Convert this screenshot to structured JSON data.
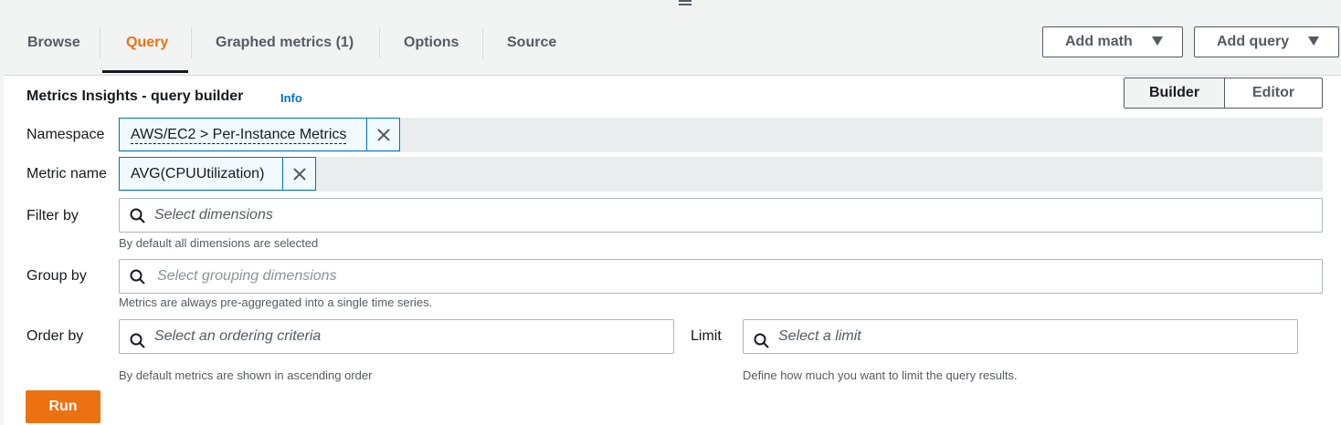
{
  "tabs": [
    {
      "label": "Browse",
      "active": false
    },
    {
      "label": "Query",
      "active": true
    },
    {
      "label": "Graphed metrics (1)",
      "active": false
    },
    {
      "label": "Options",
      "active": false
    },
    {
      "label": "Source",
      "active": false
    }
  ],
  "header_buttons": {
    "add_math": "Add math",
    "add_query": "Add query"
  },
  "builder": {
    "title": "Metrics Insights - query builder",
    "info": "Info",
    "modes": {
      "builder": "Builder",
      "editor": "Editor",
      "active": "Builder"
    },
    "namespace": {
      "label": "Namespace",
      "value": "AWS/EC2 > Per-Instance Metrics"
    },
    "metric_name": {
      "label": "Metric name",
      "value": "AVG(CPUUtilization)"
    },
    "filter_by": {
      "label": "Filter by",
      "placeholder": "Select dimensions",
      "help": "By default all dimensions are selected"
    },
    "group_by": {
      "label": "Group by",
      "placeholder": "Select grouping dimensions",
      "help": "Metrics are always pre-aggregated into a single time series."
    },
    "order_by": {
      "label": "Order by",
      "placeholder": "Select an ordering criteria",
      "help": "By default metrics are shown in ascending order"
    },
    "limit": {
      "label": "Limit",
      "placeholder": "Select a limit",
      "help": "Define how much you want to limit the query results."
    },
    "run": "Run"
  },
  "colors": {
    "accent": "#ec7211",
    "link": "#0073bb",
    "text": "#16191f",
    "muted": "#545b64"
  }
}
